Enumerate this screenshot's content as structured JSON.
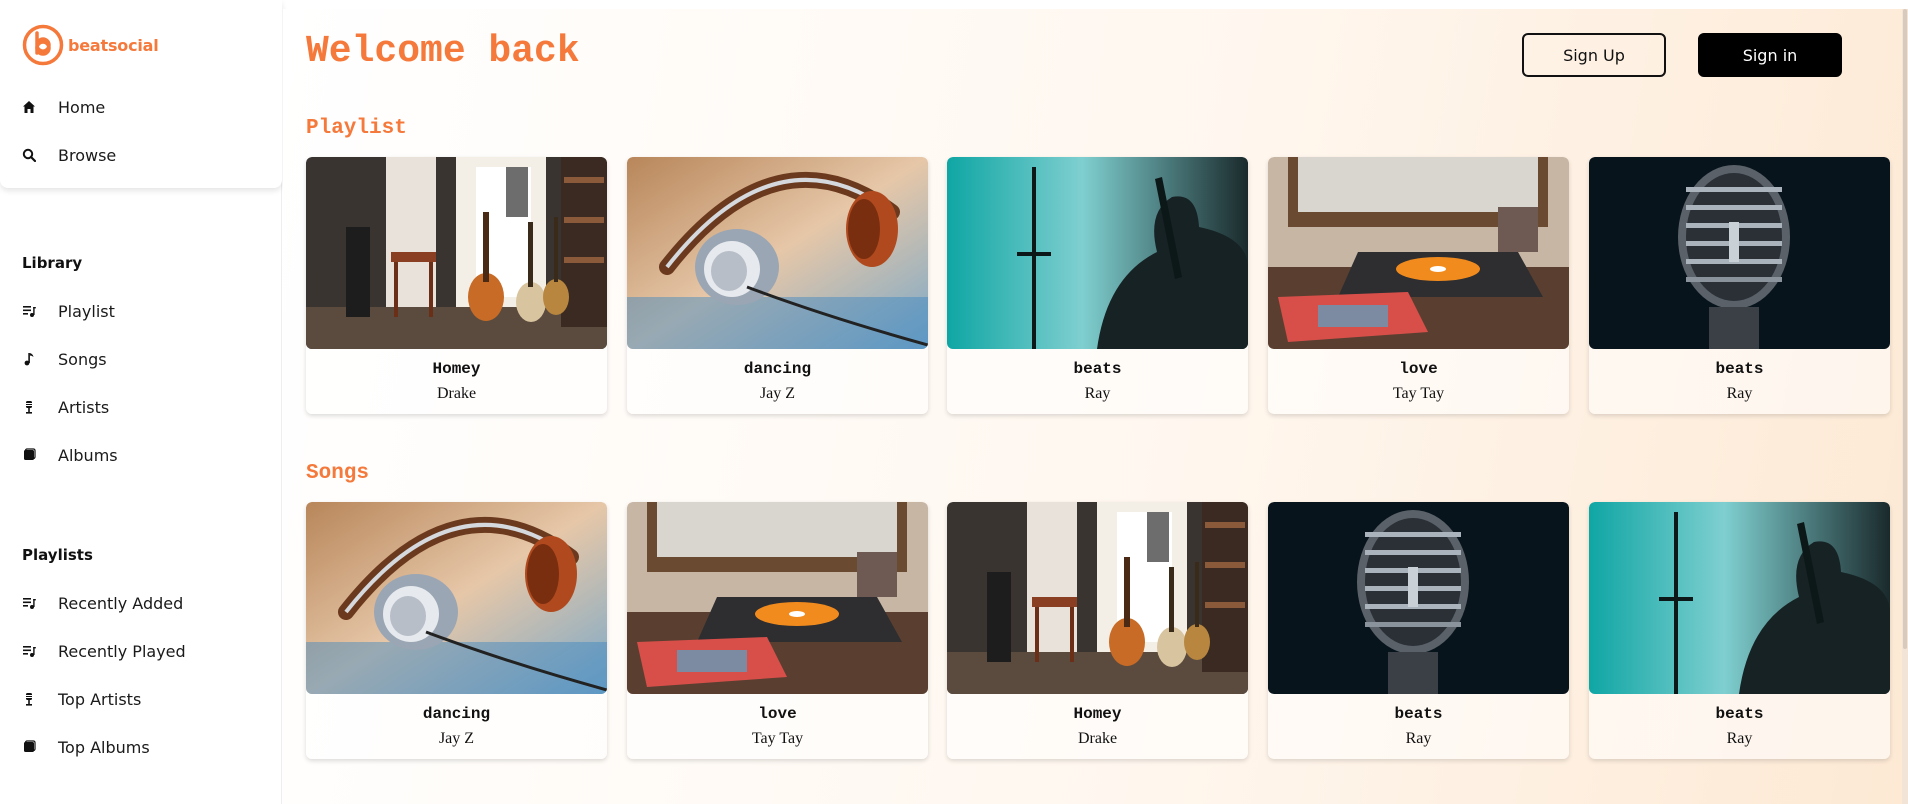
{
  "brand": {
    "name": "beatsocial",
    "accent": "#f5793b"
  },
  "nav": [
    {
      "label": "Home",
      "icon": "home-icon"
    },
    {
      "label": "Browse",
      "icon": "search-icon"
    }
  ],
  "library": {
    "title": "Library",
    "items": [
      {
        "label": "Playlist",
        "icon": "playlist-icon"
      },
      {
        "label": "Songs",
        "icon": "music-note-icon"
      },
      {
        "label": "Artists",
        "icon": "microphone-icon"
      },
      {
        "label": "Albums",
        "icon": "album-icon"
      }
    ]
  },
  "playlists": {
    "title": "Playlists",
    "items": [
      {
        "label": "Recently Added",
        "icon": "playlist-icon"
      },
      {
        "label": "Recently Played",
        "icon": "playlist-icon"
      },
      {
        "label": "Top Artists",
        "icon": "microphone-icon"
      },
      {
        "label": "Top Albums",
        "icon": "album-icon"
      }
    ]
  },
  "header": {
    "welcome": "Welcome back",
    "sign_up": "Sign Up",
    "sign_in": "Sign in"
  },
  "sections": [
    {
      "title": "Playlist",
      "cards": [
        {
          "title": "Homey",
          "artist": "Drake",
          "image": "guitar-room"
        },
        {
          "title": "dancing",
          "artist": "Jay Z",
          "image": "headphones"
        },
        {
          "title": "beats",
          "artist": "Ray",
          "image": "silhouette"
        },
        {
          "title": "love",
          "artist": "Tay Tay",
          "image": "record-player"
        },
        {
          "title": "beats",
          "artist": "Ray",
          "image": "microphone"
        }
      ]
    },
    {
      "title": "Songs",
      "cards": [
        {
          "title": "dancing",
          "artist": "Jay Z",
          "image": "headphones"
        },
        {
          "title": "love",
          "artist": "Tay Tay",
          "image": "record-player"
        },
        {
          "title": "Homey",
          "artist": "Drake",
          "image": "guitar-room"
        },
        {
          "title": "beats",
          "artist": "Ray",
          "image": "microphone"
        },
        {
          "title": "beats",
          "artist": "Ray",
          "image": "silhouette"
        }
      ]
    }
  ]
}
